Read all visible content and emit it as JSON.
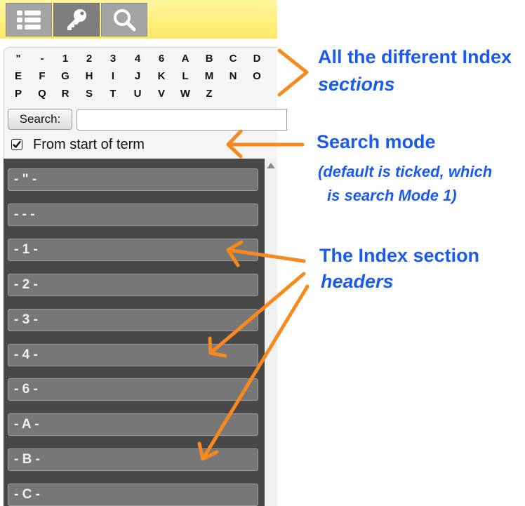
{
  "toolbar": {
    "tabs": [
      {
        "icon": "list-icon",
        "active": false
      },
      {
        "icon": "key-icon",
        "active": true
      },
      {
        "icon": "search-icon",
        "active": false
      }
    ]
  },
  "index": {
    "letters_row1": [
      "\"",
      "-",
      "1",
      "2",
      "3",
      "4",
      "6",
      "A",
      "B",
      "C",
      "D"
    ],
    "letters_row2": [
      "E",
      "F",
      "G",
      "H",
      "I",
      "J",
      "K",
      "L",
      "M",
      "N",
      "O"
    ],
    "letters_row3": [
      "P",
      "Q",
      "R",
      "S",
      "T",
      "U",
      "V",
      "W",
      "Z"
    ]
  },
  "search": {
    "button_label": "Search:",
    "value": "",
    "from_start_label": "From start of term",
    "from_start_checked": true
  },
  "sections": [
    "- \" -",
    "- - -",
    "- 1 -",
    "- 2 -",
    "- 3 -",
    "- 4 -",
    "- 6 -",
    "- A -",
    "- B -",
    "- C -"
  ],
  "annotations": {
    "index_sections_line1": "All the different Index",
    "index_sections_line2": "sections",
    "search_mode_title": "Search mode",
    "search_mode_note_line1": "(default is ticked, which",
    "search_mode_note_line2": "is search Mode 1)",
    "headers_line1": "The Index section",
    "headers_line2": "headers"
  },
  "colors": {
    "toolbar_yellow": "#ffe766",
    "annotation_blue": "#1a5bea",
    "arrow_orange": "#f7891f",
    "list_bg": "#484848",
    "header_bg": "#777777"
  }
}
